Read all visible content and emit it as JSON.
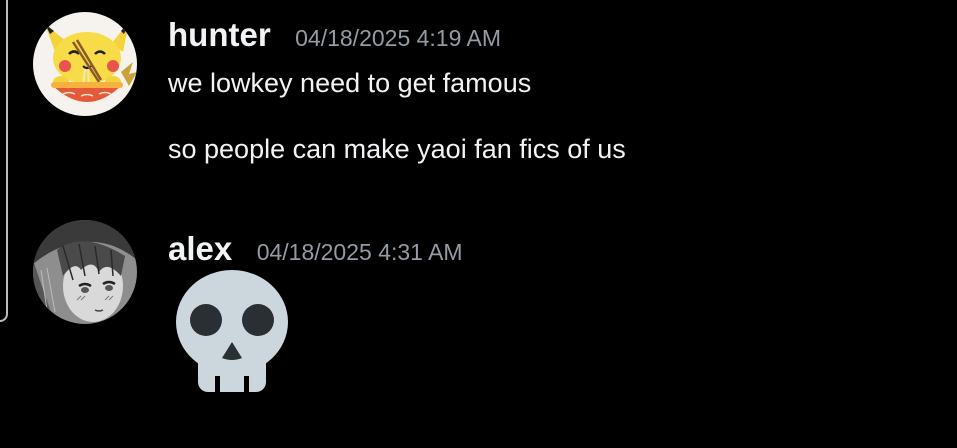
{
  "messages": [
    {
      "username": "hunter",
      "timestamp": "04/18/2025 4:19 AM",
      "avatar": "pikachu-eating-ramen-avatar",
      "lines": [
        "we lowkey need to get famous",
        "so people can make yaoi fan fics of us"
      ]
    },
    {
      "username": "alex",
      "timestamp": "04/18/2025 4:31 AM",
      "avatar": "manga-character-avatar",
      "emoji": "skull-emoji"
    }
  ],
  "colors": {
    "background": "#000000",
    "username": "#f2f3f5",
    "timestamp": "#949ba4",
    "message_text": "#f2f3f5",
    "skull": "#ccd6dd",
    "skull_features": "#292f33"
  }
}
